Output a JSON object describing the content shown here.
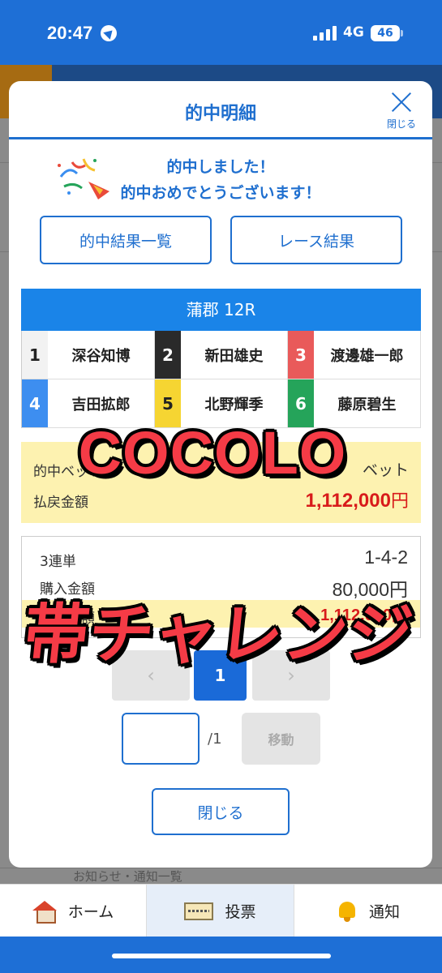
{
  "status_bar": {
    "time": "20:47",
    "network": "4G",
    "battery": "46"
  },
  "modal": {
    "title": "的中明細",
    "close_label": "閉じる",
    "congrats_line1": "的中しました！",
    "congrats_line2": "的中おめでとうございます！",
    "buttons": {
      "hit_list": "的中結果一覧",
      "race_result": "レース結果"
    },
    "race": {
      "title": "蒲郡 12R",
      "racers": [
        {
          "num": "1",
          "name": "深谷知博",
          "bg": "#f2f2f2",
          "fg": "#222222"
        },
        {
          "num": "2",
          "name": "新田雄史",
          "bg": "#2a2a2a",
          "fg": "#ffffff"
        },
        {
          "num": "3",
          "name": "渡邊雄一郎",
          "bg": "#e95a5a",
          "fg": "#ffffff"
        },
        {
          "num": "4",
          "name": "吉田拡郎",
          "bg": "#3d8ef0",
          "fg": "#ffffff"
        },
        {
          "num": "5",
          "name": "北野輝季",
          "bg": "#f6d532",
          "fg": "#222222"
        },
        {
          "num": "6",
          "name": "藤原碧生",
          "bg": "#25a45a",
          "fg": "#ffffff"
        }
      ]
    },
    "payout": {
      "hit_label": "的中ベット数",
      "hit_value": "ベット",
      "refund_label": "払戻金額",
      "refund_value": "1,112,000",
      "refund_unit": "円"
    },
    "ticket": {
      "bet_type": "3連単",
      "combination": "1-4-2",
      "purchase_label": "購入金額",
      "purchase_value": "80,000円",
      "refund_label": "払戻金額",
      "refund_value": "1,112,000円"
    },
    "pager": {
      "prev": "‹",
      "current": "1",
      "next": "›",
      "total": "/1",
      "move": "移動"
    },
    "close_button": "閉じる"
  },
  "overlay": {
    "line1": "COCOLO",
    "line2": "帯チャレンジ"
  },
  "bottom_nav": {
    "home": "ホーム",
    "vote": "投票",
    "notice": "通知"
  },
  "background": {
    "text": "お知らせ・通知一覧"
  }
}
